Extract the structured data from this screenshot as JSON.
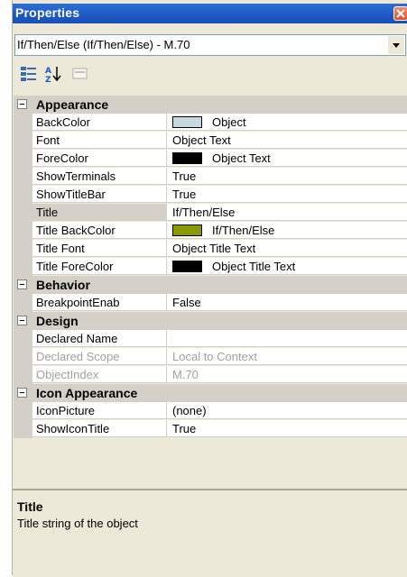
{
  "window": {
    "title": "Properties",
    "close_icon": "close-icon"
  },
  "selector": {
    "value": "If/Then/Else (If/Then/Else) - M.70"
  },
  "toolbar": {
    "buttons": [
      "categorized-icon",
      "alphabetical-icon",
      "property-pages-icon"
    ]
  },
  "categories": [
    {
      "label": "Appearance",
      "properties": [
        {
          "name": "BackColor",
          "value": "Object",
          "swatch": "#c8d8e0"
        },
        {
          "name": "Font",
          "value": "Object Text"
        },
        {
          "name": "ForeColor",
          "value": "Object Text",
          "swatch": "#000000"
        },
        {
          "name": "ShowTerminals",
          "value": "True"
        },
        {
          "name": "ShowTitleBar",
          "value": "True"
        },
        {
          "name": "Title",
          "value": "If/Then/Else",
          "selected": true
        },
        {
          "name": "Title BackColor",
          "value": "If/Then/Else",
          "swatch": "#8a9a00"
        },
        {
          "name": "Title Font",
          "value": "Object Title Text"
        },
        {
          "name": "Title ForeColor",
          "value": "Object Title Text",
          "swatch": "#000000"
        }
      ]
    },
    {
      "label": "Behavior",
      "properties": [
        {
          "name": "BreakpointEnab",
          "value": "False"
        }
      ]
    },
    {
      "label": "Design",
      "properties": [
        {
          "name": "Declared Name",
          "value": ""
        },
        {
          "name": "Declared Scope",
          "value": "Local to Context",
          "disabled": true
        },
        {
          "name": "ObjectIndex",
          "value": "M.70",
          "disabled": true
        }
      ]
    },
    {
      "label": "Icon Appearance",
      "properties": [
        {
          "name": "IconPicture",
          "value": "(none)"
        },
        {
          "name": "ShowIconTitle",
          "value": "True"
        }
      ]
    }
  ],
  "description": {
    "title": "Title",
    "text": "Title string of the object"
  }
}
